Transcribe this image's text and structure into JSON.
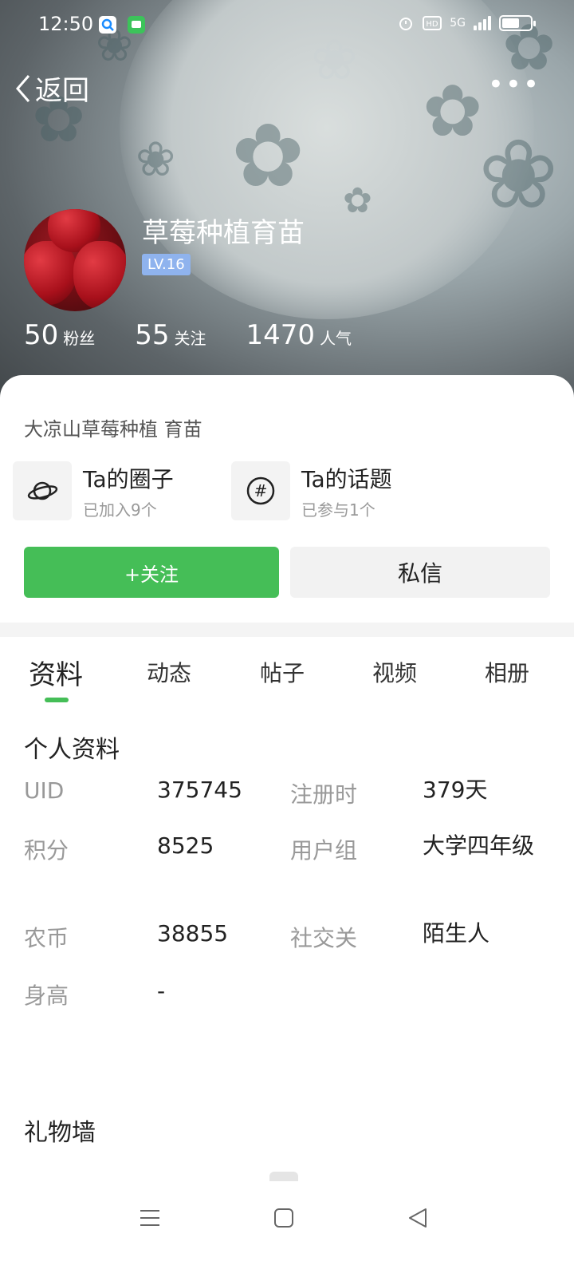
{
  "status_bar": {
    "time": "12:50",
    "network": "5G"
  },
  "nav": {
    "back_label": "返回",
    "more_label": "•••"
  },
  "profile": {
    "name": "草莓种植育苗",
    "level": "LV.16",
    "stats": [
      {
        "value": "50",
        "label": "粉丝"
      },
      {
        "value": "55",
        "label": "关注"
      },
      {
        "value": "1470",
        "label": "人气"
      }
    ]
  },
  "card": {
    "bio": "大凉山草莓种植  育苗",
    "circles": {
      "title": "Ta的圈子",
      "subtitle": "已加入9个"
    },
    "topics": {
      "title": "Ta的话题",
      "subtitle": "已参与1个"
    },
    "follow_label": "+关注",
    "message_label": "私信"
  },
  "tabs": [
    "资料",
    "动态",
    "帖子",
    "视频",
    "相册"
  ],
  "active_tab": 0,
  "personal_info": {
    "title": "个人资料",
    "rows": [
      {
        "label1": "UID",
        "value1": "375745",
        "label2": "注册时",
        "value2": "379天"
      },
      {
        "label1": "积分",
        "value1": "8525",
        "label2": "用户组",
        "value2": "大学四年级"
      },
      {
        "label1": "农币",
        "value1": "38855",
        "label2": "社交关",
        "value2": "陌生人"
      },
      {
        "label1": "身高",
        "value1": "-"
      }
    ]
  },
  "gift_wall": {
    "title": "礼物墙"
  },
  "colors": {
    "accent": "#45be57",
    "level_badge": "#8fb3ee"
  }
}
